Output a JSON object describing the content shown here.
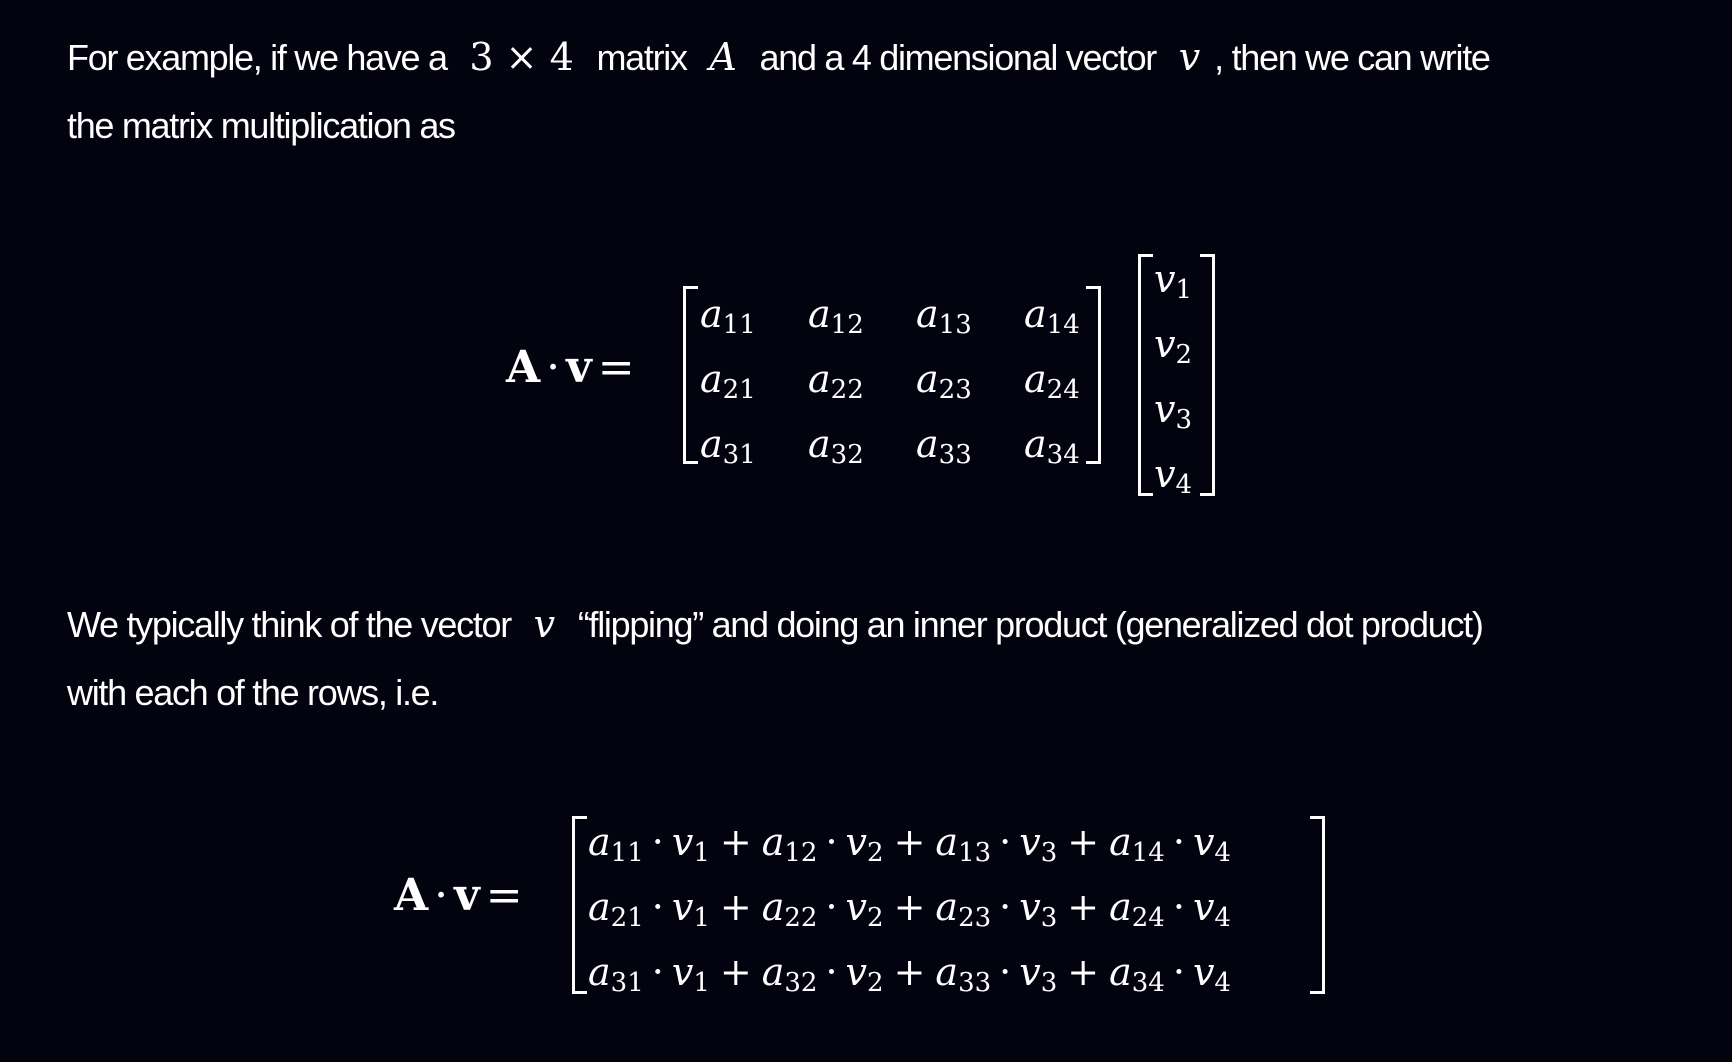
{
  "paragraph1": {
    "t1": "For example, if we have a",
    "dims": "3 × 4",
    "t2": "matrix",
    "matrix_symbol": "A",
    "t3": "and a 4 dimensional vector",
    "vector_symbol": "v",
    "t4": ", then we can write",
    "t5": "the matrix multiplication as"
  },
  "equation1": {
    "lhs_A": "A",
    "lhs_dot": "·",
    "lhs_v": "v",
    "lhs_eq": "=",
    "matrix": [
      [
        {
          "b": "a",
          "s": "11"
        },
        {
          "b": "a",
          "s": "12"
        },
        {
          "b": "a",
          "s": "13"
        },
        {
          "b": "a",
          "s": "14"
        }
      ],
      [
        {
          "b": "a",
          "s": "21"
        },
        {
          "b": "a",
          "s": "22"
        },
        {
          "b": "a",
          "s": "23"
        },
        {
          "b": "a",
          "s": "24"
        }
      ],
      [
        {
          "b": "a",
          "s": "31"
        },
        {
          "b": "a",
          "s": "32"
        },
        {
          "b": "a",
          "s": "33"
        },
        {
          "b": "a",
          "s": "34"
        }
      ]
    ],
    "vector": [
      {
        "b": "v",
        "s": "1"
      },
      {
        "b": "v",
        "s": "2"
      },
      {
        "b": "v",
        "s": "3"
      },
      {
        "b": "v",
        "s": "4"
      }
    ]
  },
  "paragraph2": {
    "t1": "We typically think of the vector",
    "vector_symbol": "v",
    "t2": "“flipping” and doing an inner product (generalized dot product)",
    "t3": "with each of the rows, i.e."
  },
  "equation2": {
    "lhs_A": "A",
    "lhs_dot": "·",
    "lhs_v": "v",
    "lhs_eq": "=",
    "plus": "+",
    "dot": "·",
    "rows": [
      [
        {
          "a": "11",
          "v": "1"
        },
        {
          "a": "12",
          "v": "2"
        },
        {
          "a": "13",
          "v": "3"
        },
        {
          "a": "14",
          "v": "4"
        }
      ],
      [
        {
          "a": "21",
          "v": "1"
        },
        {
          "a": "22",
          "v": "2"
        },
        {
          "a": "23",
          "v": "3"
        },
        {
          "a": "24",
          "v": "4"
        }
      ],
      [
        {
          "a": "31",
          "v": "1"
        },
        {
          "a": "32",
          "v": "2"
        },
        {
          "a": "33",
          "v": "3"
        },
        {
          "a": "34",
          "v": "4"
        }
      ]
    ],
    "a_base": "a",
    "v_base": "v"
  }
}
